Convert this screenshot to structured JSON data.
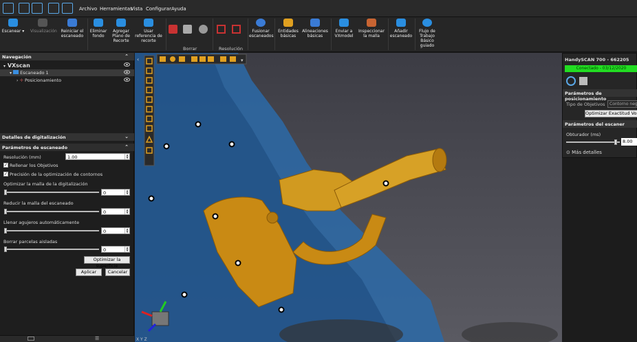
{
  "menu": {
    "items": [
      "Archivo",
      "Herramientas",
      "Vista",
      "Configurar",
      "Ayuda"
    ]
  },
  "ribbon": {
    "scan": "Escanear",
    "visualization": "Visualización",
    "restart": "Reiniciar el escaneado",
    "remove_bg": "Eliminar fondo",
    "add_plane": "Agregar Plano de Recorte",
    "use_ref": "Usar referencia de recorte",
    "erase_group": "Borrar",
    "resolution_group": "Resolución",
    "merge": "Fusionar escaneados",
    "basic_entities": "Entidades básicas",
    "basic_align": "Alineaciones básicas",
    "send_vxmodel": "Enviar a VXmodel",
    "inspect_mesh": "Inspeccionar la malla",
    "add_scan": "Añadir escaneado",
    "workflow": "Flujo de Trabajo Básico guiado"
  },
  "nav": {
    "title": "Navegación",
    "root": "VXscan",
    "scan1": "Escaneado 1",
    "positioning": "Posicionamiento"
  },
  "details": {
    "title": "Detalles de digitalización"
  },
  "params": {
    "title": "Parámetros de escaneado",
    "resolution_label": "Resolución (mm)",
    "resolution_value": "1.00",
    "fill_targets": "Rellenar los Objetivos",
    "contour_opt": "Precisión de la optimización de contornos",
    "opt_mesh": "Optimizar la malla de la digitalización",
    "opt_mesh_value": "0",
    "reduce_mesh": "Reducir la malla del escaneado",
    "reduce_mesh_value": "0",
    "fill_holes": "Llenar agujeros automáticamente",
    "fill_holes_value": "0",
    "remove_isolated": "Borrar parcelas aisladas",
    "remove_isolated_value": "0",
    "optimize_surface": "Optimizar la superficie",
    "apply": "Aplicar",
    "cancel": "Cancelar"
  },
  "device": {
    "name": "HandySCAN 700 - 662205",
    "status": "Conectado - 03/12/2020",
    "status_color": "#22dd22",
    "pos_params": "Parámetros de posicionamiento",
    "target_type_label": "Tipo de Objetivos",
    "target_type_value": "Contorno negro",
    "optimize_volume": "Optimizar Exactitud Volume",
    "scanner_params": "Parámetros del escaner",
    "shutter_label": "Obturador (ms)",
    "shutter_value": "8.00",
    "shutter_fraction": 0.94,
    "more_details": "Más detalles"
  },
  "viewport": {
    "axis_label": "X Y Z"
  }
}
